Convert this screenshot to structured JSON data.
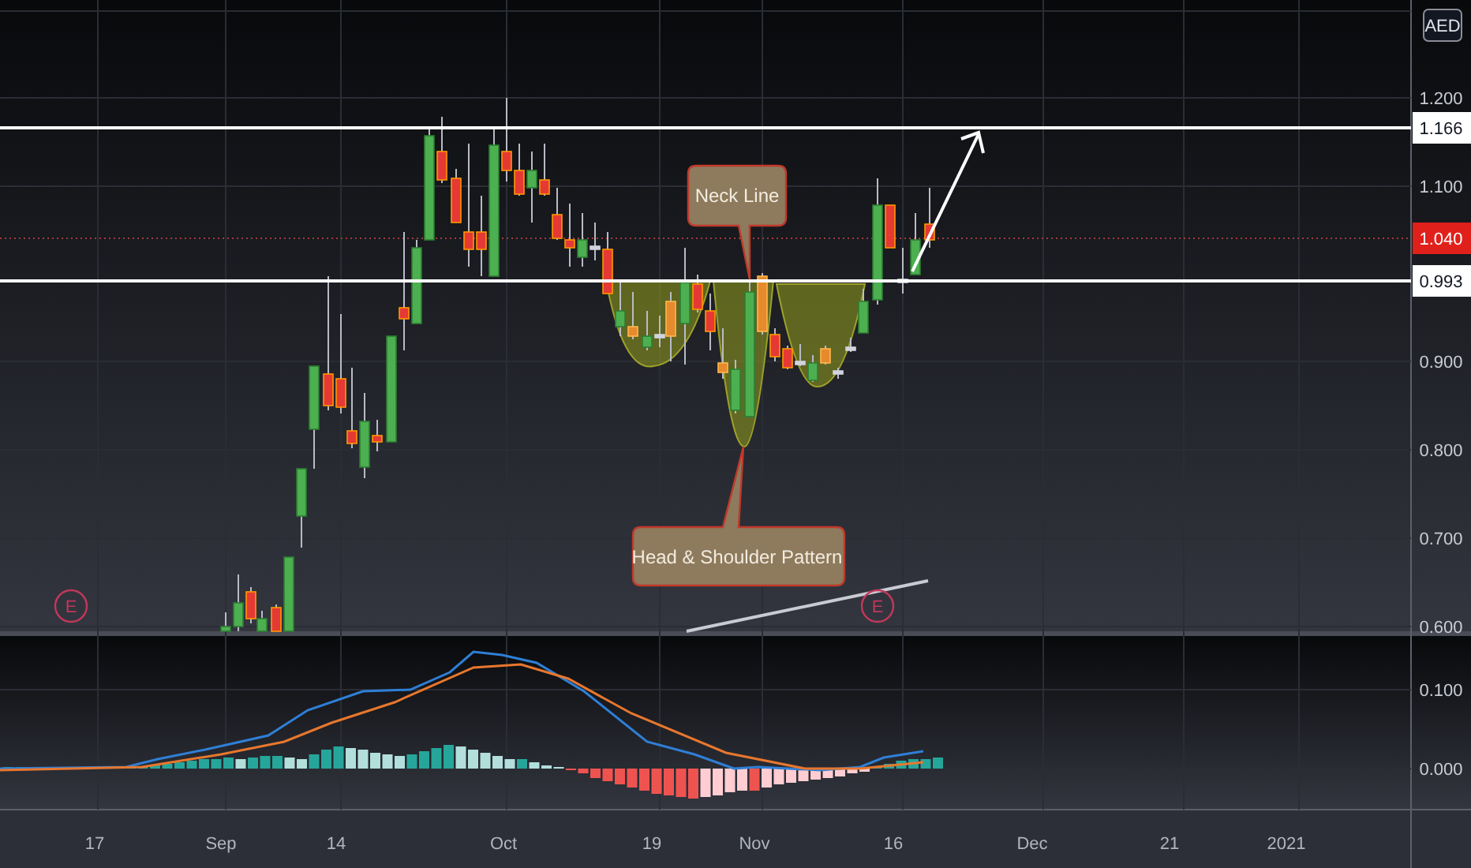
{
  "price_axis": {
    "currency": "AED",
    "labels": [
      "1.200",
      "1.100",
      "0.900",
      "0.800",
      "0.700",
      "0.600"
    ]
  },
  "price_tags": [
    {
      "text": "1.166",
      "kind": "level"
    },
    {
      "text": "1.040",
      "kind": "last"
    },
    {
      "text": "0.993",
      "kind": "level"
    }
  ],
  "annotations": [
    {
      "text": "Neck Line",
      "kind": "top"
    },
    {
      "text": "Head & Shoulder Pattern",
      "kind": "bottom"
    }
  ],
  "earnings_markers": [
    "E",
    "E"
  ],
  "macd_axis": {
    "labels": [
      "0.100",
      "0.000"
    ]
  },
  "time_axis": {
    "labels": [
      "17",
      "Sep",
      "14",
      "Oct",
      "19",
      "Nov",
      "16",
      "Dec",
      "21",
      "2021"
    ]
  }
}
